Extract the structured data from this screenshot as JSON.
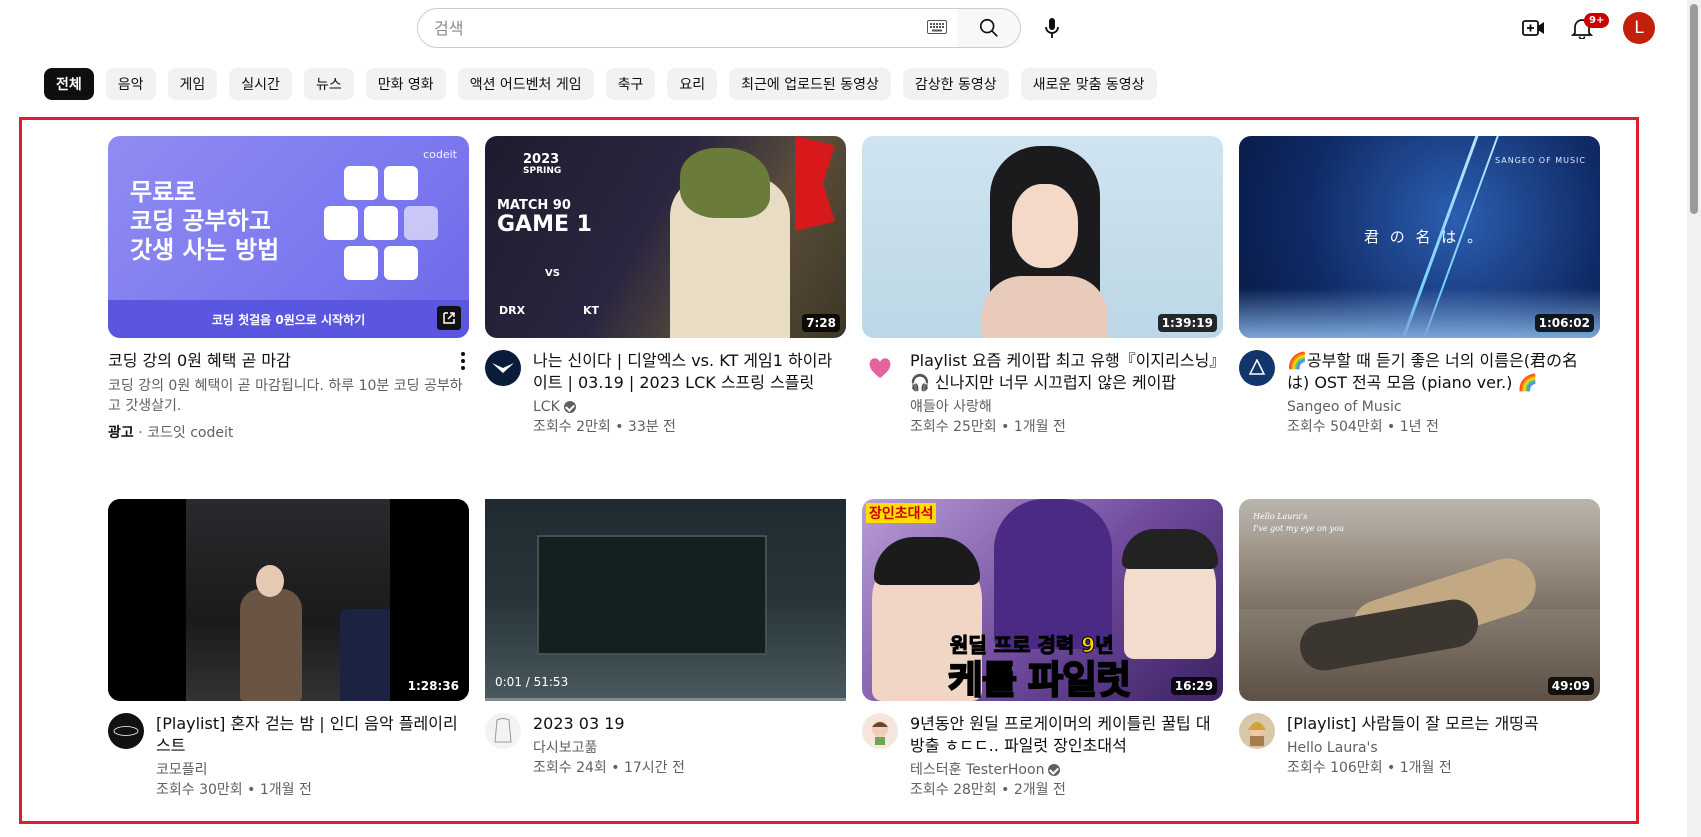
{
  "header": {
    "search_placeholder": "검색",
    "notif_count": "9+",
    "user_initial": "L"
  },
  "chips": [
    "전체",
    "음악",
    "게임",
    "실시간",
    "뉴스",
    "만화 영화",
    "액션 어드벤처 게임",
    "축구",
    "요리",
    "최근에 업로드된 동영상",
    "감상한 동영상",
    "새로운 맞춤 동영상"
  ],
  "ad": {
    "thumb_heading": [
      "무료로",
      "코딩 공부하고",
      "갓생 사는 방법"
    ],
    "thumb_brand": "codeit",
    "thumb_cta": "코딩 첫걸음 0원으로 시작하기",
    "title": "코딩 강의 0원 혜택 곧 마감",
    "desc": "코딩 강의 0원 혜택이 곧 마감됩니다. 하루 10분 코딩 공부하고 갓생살기.",
    "label": "광고",
    "advertiser": "코드잇 codeit"
  },
  "videos": [
    {
      "title": "나는 신이다 | 디알엑스 vs. KT 게임1 하이라이트 | 03.19 | 2023 LCK 스프링 스플릿",
      "channel": "LCK",
      "verified": true,
      "stats": "조회수 2만회 • 33분 전",
      "duration": "7:28",
      "thumb_text": {
        "year": "2023",
        "season": "SPRING",
        "match": "MATCH 90",
        "game": "GAME 1",
        "vs": "VS",
        "team1": "DRX",
        "team2": "KT"
      }
    },
    {
      "title": "Playlist 요즘 케이팝 최고 유행『이지리스닝』🎧 신나지만 너무 시끄럽지 않은 케이팝",
      "channel": "얘들아 사랑해",
      "verified": false,
      "stats": "조회수 25만회 • 1개월 전",
      "duration": "1:39:19"
    },
    {
      "title": "🌈공부할 때 듣기 좋은 너의 이름은(君の名は) OST 전곡 모음 (piano ver.) 🌈",
      "channel": "Sangeo of Music",
      "verified": false,
      "stats": "조회수 504만회 • 1년 전",
      "duration": "1:06:02",
      "thumb_text": {
        "title": "君 の 名 は 。",
        "tag": "SANGEO OF MUSIC"
      }
    },
    {
      "title": "[Playlist] 혼자 걷는 밤 | 인디 음악 플레이리스트",
      "channel": "코모플리",
      "verified": false,
      "stats": "조회수 30만회 • 1개월 전",
      "duration": "1:28:36"
    },
    {
      "title": "2023 03 19",
      "channel": "다시보고풂",
      "verified": false,
      "stats": "조회수 24회 • 17시간 전",
      "player_time": "0:01 / 51:53"
    },
    {
      "title": "9년동안 원딜 프로게이머의 케이틀린 꿀팁 대방출 ㅎㄷㄷ.. 파일럿 장인초대석",
      "channel": "테스터훈 TesterHoon",
      "verified": true,
      "stats": "조회수 28만회 • 2개월 전",
      "duration": "16:29",
      "thumb_text": {
        "tag": "장인초대석",
        "cap1": "원딜 프로 경력 9년",
        "cap2": "케틀 파일럿"
      }
    },
    {
      "title": "[Playlist] 사람들이 잘 모르는 개띵곡",
      "channel": "Hello Laura's",
      "verified": false,
      "stats": "조회수 106만회 • 1개월 전",
      "duration": "49:09",
      "thumb_text": {
        "line1": "Hello Laura's",
        "line2": "I've got my eye on you"
      }
    }
  ],
  "colors": {
    "highlight": "#e01e2a",
    "brand_red": "#cc0000"
  }
}
